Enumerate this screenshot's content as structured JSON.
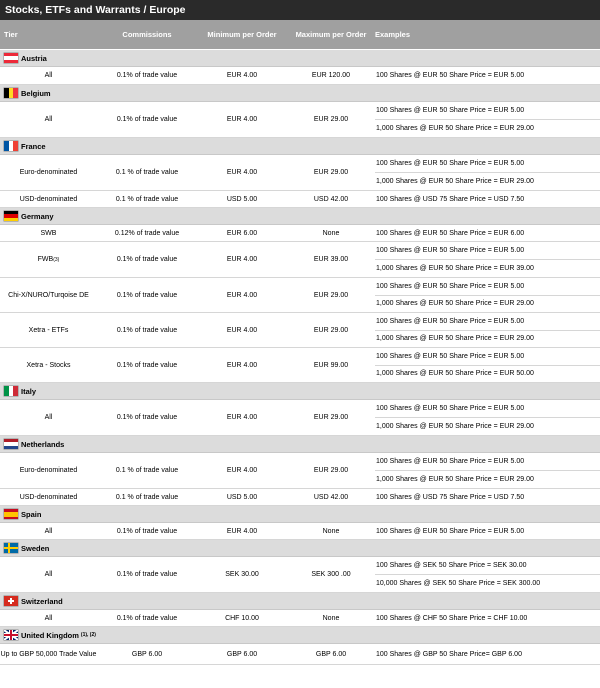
{
  "title": "Stocks, ETFs and Warrants / Europe",
  "headers": {
    "tier": "Tier",
    "commissions": "Commissions",
    "min": "Minimum per Order",
    "max": "Maximum per Order",
    "examples": "Examples"
  },
  "countries": [
    {
      "name": "Austria",
      "flag": "austria",
      "sup": "",
      "rows": [
        {
          "tier": "All",
          "commission": "0.1% of trade value",
          "min": "EUR 4.00",
          "max": "EUR 120.00",
          "examples": [
            "100 Shares @ EUR 50 Share Price = EUR 5.00"
          ]
        }
      ]
    },
    {
      "name": "Belgium",
      "flag": "belgium",
      "sup": "",
      "rows": [
        {
          "tier": "All",
          "commission": "0.1% of trade value",
          "min": "EUR 4.00",
          "max": "EUR 29.00",
          "examples": [
            "100 Shares @ EUR 50 Share Price = EUR 5.00",
            "1,000 Shares @ EUR 50 Share Price = EUR 29.00"
          ]
        }
      ]
    },
    {
      "name": "France",
      "flag": "france",
      "sup": "",
      "rows": [
        {
          "tier": "Euro-denominated",
          "commission": "0.1 % of trade value",
          "min": "EUR 4.00",
          "max": "EUR 29.00",
          "examples": [
            "100 Shares @ EUR 50 Share Price = EUR 5.00",
            "1,000 Shares @ EUR 50 Share Price = EUR 29.00"
          ]
        },
        {
          "tier": "USD-denominated",
          "commission": "0.1 % of trade value",
          "min": "USD 5.00",
          "max": "USD 42.00",
          "examples": [
            "100 Shares @ USD 75 Share Price = USD 7.50"
          ]
        }
      ]
    },
    {
      "name": "Germany",
      "flag": "germany",
      "sup": "",
      "rows": [
        {
          "tier": "SWB",
          "commission": "0.12% of trade value",
          "min": "EUR 6.00",
          "max": "None",
          "examples": [
            "100 Shares @ EUR 50 Share Price = EUR 6.00"
          ]
        },
        {
          "tier": "FWB",
          "tier_sup": "(3)",
          "commission": "0.1% of trade value",
          "min": "EUR 4.00",
          "max": "EUR 39.00",
          "examples": [
            "100 Shares @ EUR 50 Share Price = EUR 5.00",
            "1,000 Shares @ EUR 50 Share Price = EUR 39.00"
          ]
        },
        {
          "tier": "Chi-X/NURO/Turqoise DE",
          "commission": "0.1% of trade value",
          "min": "EUR 4.00",
          "max": "EUR 29.00",
          "examples": [
            "100 Shares @ EUR 50 Share Price = EUR 5.00",
            "1,000 Shares @ EUR 50 Share Price = EUR 29.00"
          ]
        },
        {
          "tier": "Xetra - ETFs",
          "commission": "0.1% of trade value",
          "min": "EUR 4.00",
          "max": "EUR 29.00",
          "examples": [
            "100 Shares @ EUR 50 Share Price = EUR 5.00",
            "1,000 Shares @ EUR 50 Share Price = EUR 29.00"
          ]
        },
        {
          "tier": "Xetra - Stocks",
          "commission": "0.1% of trade value",
          "min": "EUR 4.00",
          "max": "EUR 99.00",
          "examples": [
            "100 Shares @ EUR 50 Share Price = EUR 5.00",
            "1,000 Shares @ EUR 50 Share Price = EUR 50.00"
          ]
        }
      ]
    },
    {
      "name": "Italy",
      "flag": "italy",
      "sup": "",
      "rows": [
        {
          "tier": "All",
          "commission": "0.1% of trade value",
          "min": "EUR 4.00",
          "max": "EUR 29.00",
          "examples": [
            "100 Shares @ EUR 50 Share Price = EUR 5.00",
            "1,000 Shares @ EUR 50 Share Price = EUR 29.00"
          ]
        }
      ]
    },
    {
      "name": "Netherlands",
      "flag": "netherlands",
      "sup": "",
      "rows": [
        {
          "tier": "Euro-denominated",
          "commission": "0.1 % of trade value",
          "min": "EUR 4.00",
          "max": "EUR 29.00",
          "examples": [
            "100 Shares @ EUR 50 Share Price = EUR 5.00",
            "1,000 Shares @ EUR 50 Share Price = EUR 29.00"
          ]
        },
        {
          "tier": "USD-denominated",
          "commission": "0.1 % of trade value",
          "min": "USD 5.00",
          "max": "USD 42.00",
          "examples": [
            "100 Shares @ USD 75 Share Price = USD 7.50"
          ]
        }
      ]
    },
    {
      "name": "Spain",
      "flag": "spain",
      "sup": "",
      "rows": [
        {
          "tier": "All",
          "commission": "0.1% of trade value",
          "min": "EUR 4.00",
          "max": "None",
          "examples": [
            "100 Shares @ EUR 50 Share Price = EUR 5.00"
          ]
        }
      ]
    },
    {
      "name": "Sweden",
      "flag": "sweden",
      "sup": "",
      "rows": [
        {
          "tier": "All",
          "commission": "0.1% of trade value",
          "min": "SEK 30.00",
          "max": "SEK 300 .00",
          "examples": [
            "100 Shares @ SEK 50 Share Price = SEK 30.00",
            "10,000 Shares @ SEK 50 Share Price = SEK 300.00"
          ]
        }
      ]
    },
    {
      "name": "Switzerland",
      "flag": "switzerland",
      "sup": "",
      "rows": [
        {
          "tier": "All",
          "commission": "0.1% of trade value",
          "min": "CHF 10.00",
          "max": "None",
          "examples": [
            "100 Shares @ CHF 50 Share Price = CHF 10.00"
          ]
        }
      ]
    },
    {
      "name": "United Kingdom",
      "flag": "uk",
      "sup": "(1), (2)",
      "rows": [
        {
          "tier": "Up to GBP 50,000 Trade Value",
          "commission": "GBP 6.00",
          "min": "GBP 6.00",
          "max": "GBP 6.00",
          "examples": [
            "100 Shares @ GBP 50 Share Price= GBP 6.00"
          ]
        }
      ]
    }
  ],
  "colors": {
    "title_bg": "#2a2a2a",
    "header_bg": "#a0a0a0",
    "country_bg": "#dcdcdc"
  }
}
